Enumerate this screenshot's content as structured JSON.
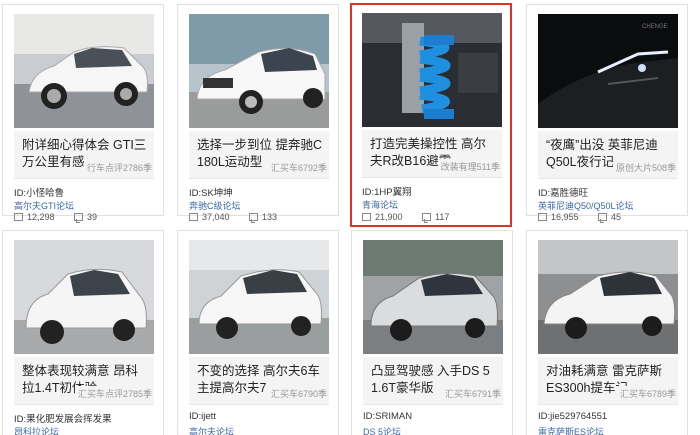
{
  "cards": [
    {
      "title": "附详细心得体会 GTI三万公里有感",
      "tag": "行车点评2786季",
      "user": "ID:小怪哈鲁",
      "forum": "高尔夫GTI论坛",
      "views": "12,298",
      "comments": "39",
      "photo": "white-golf",
      "selected": false
    },
    {
      "title": "选择一步到位 提奔驰C 180L运动型",
      "tag": "汇买车6792季",
      "user": "ID:SK坤坤",
      "forum": "奔驰C级论坛",
      "views": "37,040",
      "comments": "133",
      "photo": "white-benz",
      "selected": false
    },
    {
      "title": "打造完美操控性 高尔夫R改B16避震",
      "tag": "改装有理511季",
      "user": "ID:1HP翼翔",
      "forum": "青海论坛",
      "views": "21,900",
      "comments": "117",
      "photo": "blue-coilover",
      "selected": true
    },
    {
      "title": "“夜鹰”出没 英菲尼迪Q50L夜行记",
      "tag": "原创大片508季",
      "user": "ID:嘉胜德旺",
      "forum": "英菲尼迪Q50/Q50L论坛",
      "views": "16,955",
      "comments": "45",
      "photo": "night-infiniti",
      "selected": false
    },
    {
      "title": "整体表现较满意 昂科拉1.4T初体验",
      "tag": "汇买车点评2785季",
      "user": "ID:果化肥发展会挥发果",
      "forum": "昂科拉论坛",
      "photo": "white-encore",
      "selected": false
    },
    {
      "title": "不变的选择 高尔夫6车主提高尔夫7",
      "tag": "汇买车6790季",
      "user": "ID:ijett",
      "forum": "高尔夫论坛",
      "photo": "white-golf7",
      "selected": false
    },
    {
      "title": "凸显驾驶感 入手DS 5 1.6T豪华版",
      "tag": "汇买车6791季",
      "user": "ID:SRIMAN",
      "forum": "DS 5论坛",
      "photo": "silver-ds5",
      "selected": false
    },
    {
      "title": "对油耗满意 雷克萨斯ES300h提车记",
      "tag": "汇买车6789季",
      "user": "ID:jie529764551",
      "forum": "雷克萨斯ES论坛",
      "photo": "white-lexus",
      "selected": false
    }
  ]
}
